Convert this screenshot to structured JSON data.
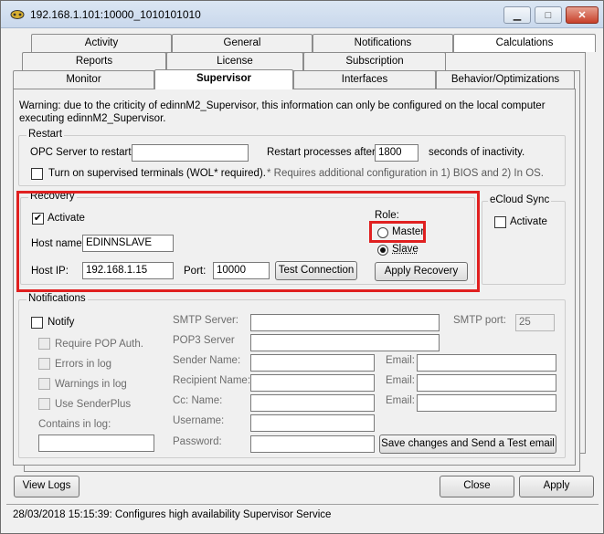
{
  "window": {
    "title": "192.168.1.101:10000_1010101010",
    "minimize_glyph": "▁",
    "maximize_glyph": "□",
    "close_glyph": "✕"
  },
  "tabs": {
    "row1": [
      "Activity",
      "General",
      "Notifications",
      "Calculations"
    ],
    "row2": [
      "Reports",
      "License",
      "Subscription"
    ],
    "row3": [
      "Monitor",
      "Supervisor",
      "Interfaces",
      "Behavior/Optimizations"
    ],
    "active": "Supervisor"
  },
  "warning": "Warning: due to the criticity of edinnM2_Supervisor, this information can only be configured on the local computer executing edinnM2_Supervisor.",
  "restart": {
    "group_label": "Restart",
    "opc_label": "OPC Server to restart:",
    "opc_value": "",
    "restart_after_label": "Restart processes after:",
    "restart_after_value": "1800",
    "inactivity_label": "seconds of inactivity.",
    "wol_label": "Turn on supervised terminals (WOL* required).",
    "wol_checked": false,
    "footnote": "* Requires additional configuration in 1) BIOS and 2) In OS."
  },
  "recovery": {
    "group_label": "Recovery",
    "activate_label": "Activate",
    "activate_checked": true,
    "hostname_label": "Host name:",
    "hostname_value": "EDINNSLAVE",
    "hostip_label": "Host IP:",
    "hostip_value": "192.168.1.15",
    "port_label": "Port:",
    "port_value": "10000",
    "test_button": "Test Connection",
    "role_label": "Role:",
    "master_label": "Master",
    "slave_label": "Slave",
    "selected_role": "Slave",
    "apply_button": "Apply Recovery"
  },
  "ecloud": {
    "group_label": "eCloud Sync",
    "activate_label": "Activate",
    "activate_checked": false
  },
  "notifications": {
    "group_label": "Notifications",
    "notify_label": "Notify",
    "require_pop_label": "Require POP Auth.",
    "errors_label": "Errors in log",
    "warnings_label": "Warnings in log",
    "senderplus_label": "Use SenderPlus",
    "contains_label": "Contains in log:",
    "smtp_server_label": "SMTP Server:",
    "pop3_label": "POP3 Server",
    "sender_label": "Sender Name:",
    "recipient_label": "Recipient Name:",
    "cc_label": "Cc: Name:",
    "username_label": "Username:",
    "password_label": "Password:",
    "email_label": "Email:",
    "smtp_port_label": "SMTP port:",
    "smtp_port_value": "25",
    "save_button": "Save changes and Send a Test email"
  },
  "footer": {
    "view_logs": "View Logs",
    "close": "Close",
    "apply": "Apply",
    "status": "28/03/2018 15:15:39: Configures high availability Supervisor Service"
  },
  "colors": {
    "highlight": "#e02020",
    "title_bar": "#c9d8ec"
  }
}
